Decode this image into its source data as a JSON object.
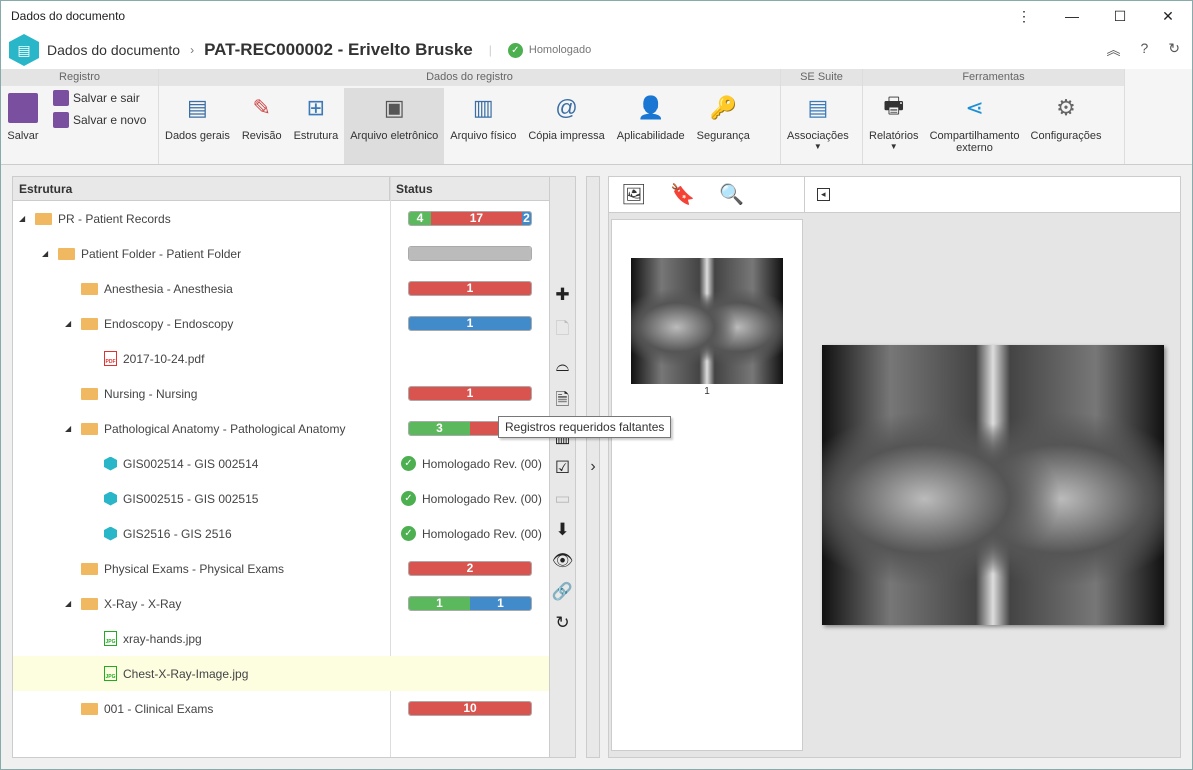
{
  "window": {
    "title": "Dados do documento"
  },
  "header": {
    "crumb": "Dados do documento",
    "title": "PAT-REC000002 - Erivelto Bruske",
    "status": "Homologado"
  },
  "ribbon": {
    "groups": [
      "Registro",
      "Dados do registro",
      "SE Suite",
      "Ferramentas"
    ],
    "save": "Salvar",
    "save_exit": "Salvar e sair",
    "save_new": "Salvar e novo",
    "items": [
      "Dados gerais",
      "Revisão",
      "Estrutura",
      "Arquivo eletrônico",
      "Arquivo físico",
      "Cópia impressa",
      "Aplicabilidade",
      "Segurança"
    ],
    "suite": [
      "Associações"
    ],
    "tools": [
      "Relatórios",
      "Compartilhamento externo",
      "Configurações"
    ]
  },
  "tree": {
    "col_structure": "Estrutura",
    "col_status": "Status",
    "rows": [
      {
        "name": "PR - Patient Records",
        "type": "folder"
      },
      {
        "name": "Patient Folder - Patient Folder",
        "type": "folder"
      },
      {
        "name": "Anesthesia - Anesthesia",
        "type": "folder"
      },
      {
        "name": "Endoscopy - Endoscopy",
        "type": "folder"
      },
      {
        "name": "2017-10-24.pdf",
        "type": "pdf"
      },
      {
        "name": "Nursing - Nursing",
        "type": "folder"
      },
      {
        "name": "Pathological Anatomy - Pathological Anatomy",
        "type": "folder"
      },
      {
        "name": "GIS002514 - GIS 002514",
        "type": "record",
        "status": "Homologado Rev. (00)"
      },
      {
        "name": "GIS002515 - GIS 002515",
        "type": "record",
        "status": "Homologado Rev. (00)"
      },
      {
        "name": "GIS2516 - GIS 2516",
        "type": "record",
        "status": "Homologado Rev. (00)"
      },
      {
        "name": "Physical Exams - Physical Exams",
        "type": "folder"
      },
      {
        "name": "X-Ray - X-Ray",
        "type": "folder"
      },
      {
        "name": "xray-hands.jpg",
        "type": "jpg"
      },
      {
        "name": "Chest-X-Ray-Image.jpg",
        "type": "jpg",
        "selected": true
      },
      {
        "name": "001 - Clinical Exams",
        "type": "folder"
      }
    ],
    "bars": {
      "0": [
        [
          "#5cb85c",
          "4"
        ],
        [
          "#d9534f",
          "17"
        ],
        [
          "#428bca",
          "2"
        ]
      ],
      "1": [
        [
          "#bbbbbb",
          ""
        ]
      ],
      "2": [
        [
          "#d9534f",
          "1"
        ]
      ],
      "3": [
        [
          "#428bca",
          "1"
        ]
      ],
      "5": [
        [
          "#d9534f",
          "1"
        ]
      ],
      "6": [
        [
          "#5cb85c",
          "3"
        ],
        [
          "#d9534f",
          ""
        ]
      ],
      "10": [
        [
          "#d9534f",
          "2"
        ]
      ],
      "11": [
        [
          "#5cb85c",
          "1"
        ],
        [
          "#428bca",
          "1"
        ]
      ],
      "14": [
        [
          "#d9534f",
          "10"
        ]
      ]
    }
  },
  "tooltip": "Registros requeridos faltantes",
  "viewer": {
    "thumb_page": "1"
  }
}
